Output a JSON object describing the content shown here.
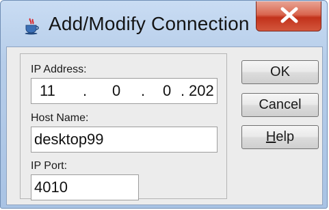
{
  "window": {
    "title": "Add/Modify Connection",
    "icon": "java-cup-icon",
    "close_icon": "close-x-icon"
  },
  "form": {
    "ip_label": "IP Address:",
    "ip_octets": [
      "11",
      "0",
      "0",
      "202"
    ],
    "ip_separators": [
      ".",
      ".",
      "."
    ],
    "host_label": "Host Name:",
    "host_value": "desktop99",
    "port_label": "IP Port:",
    "port_value": "4010"
  },
  "buttons": {
    "ok": "OK",
    "cancel": "Cancel",
    "help_mnemonic": "H",
    "help_rest": "elp"
  },
  "colors": {
    "close_button": "#c2321b",
    "titlebar": "#b6cde9",
    "client_bg": "#ececec"
  }
}
